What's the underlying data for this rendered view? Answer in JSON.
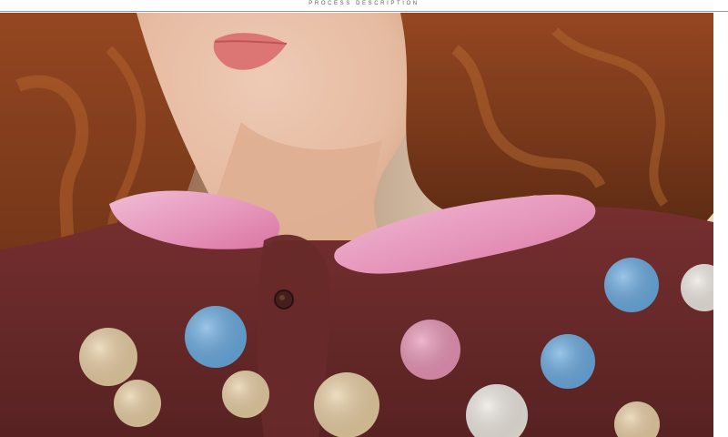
{
  "header": {
    "title": "PROCESS DESCRIPTION"
  },
  "photo": {
    "subject": "close-up of a woman in a polka-dot fleece robe",
    "colors": {
      "skin": "#f0c7ad",
      "lips": "#e47a78",
      "hair": "#8a4320",
      "robe": "#6f2e2e",
      "collar": "#f1a6c8",
      "dot_blue": "#6fb2ea",
      "dot_pink": "#f29bbd",
      "dot_white": "#f7f1ea",
      "dot_cream": "#f2d7aa"
    }
  }
}
